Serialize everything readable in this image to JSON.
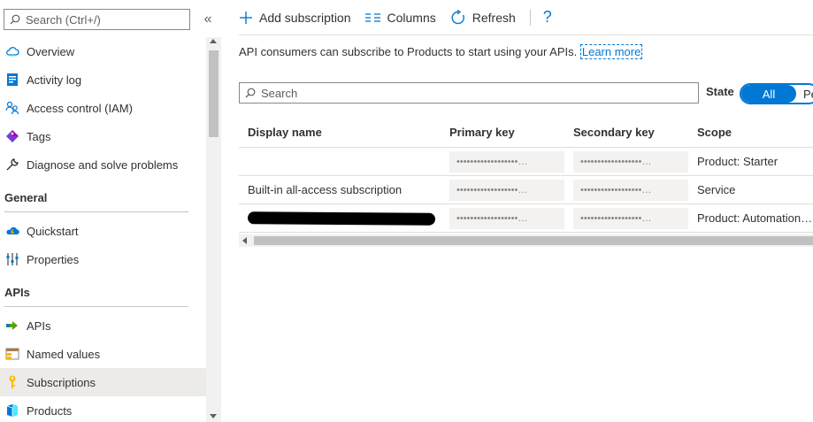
{
  "sidebar": {
    "search_placeholder": "Search (Ctrl+/)",
    "collapse_glyph": "«",
    "items": [
      {
        "label": "Overview",
        "icon": "cloud-icon"
      },
      {
        "label": "Activity log",
        "icon": "activity-log-icon"
      },
      {
        "label": "Access control (IAM)",
        "icon": "people-icon"
      },
      {
        "label": "Tags",
        "icon": "tag-icon"
      },
      {
        "label": "Diagnose and solve problems",
        "icon": "wrench-icon"
      }
    ],
    "sections": [
      {
        "title": "General",
        "items": [
          {
            "label": "Quickstart",
            "icon": "cloud-lightning-icon"
          },
          {
            "label": "Properties",
            "icon": "sliders-icon"
          }
        ]
      },
      {
        "title": "APIs",
        "items": [
          {
            "label": "APIs",
            "icon": "api-arrow-icon"
          },
          {
            "label": "Named values",
            "icon": "table-grid-icon"
          },
          {
            "label": "Subscriptions",
            "icon": "key-icon",
            "active": true
          },
          {
            "label": "Products",
            "icon": "product-box-icon"
          }
        ]
      }
    ]
  },
  "toolbar": {
    "add_label": "Add subscription",
    "columns_label": "Columns",
    "refresh_label": "Refresh",
    "help_glyph": "?"
  },
  "intro": {
    "text": "API consumers can subscribe to Products to start using your APIs.",
    "link": "Learn more"
  },
  "filter": {
    "search_placeholder": "Search",
    "state_label": "State",
    "state_selected": "All",
    "state_next": "Pe"
  },
  "table": {
    "headers": [
      "Display name",
      "Primary key",
      "Secondary key",
      "Scope"
    ],
    "masked_key": "••••••••••••••••••…",
    "rows": [
      {
        "name": "",
        "scope": "Product: Starter"
      },
      {
        "name": "Built-in all-access subscription",
        "scope": "Service"
      },
      {
        "name": "",
        "scope": "Product: Automation…",
        "redacted": true
      }
    ]
  },
  "colors": {
    "accent": "#0078d4",
    "active_bg": "#edebe9"
  }
}
